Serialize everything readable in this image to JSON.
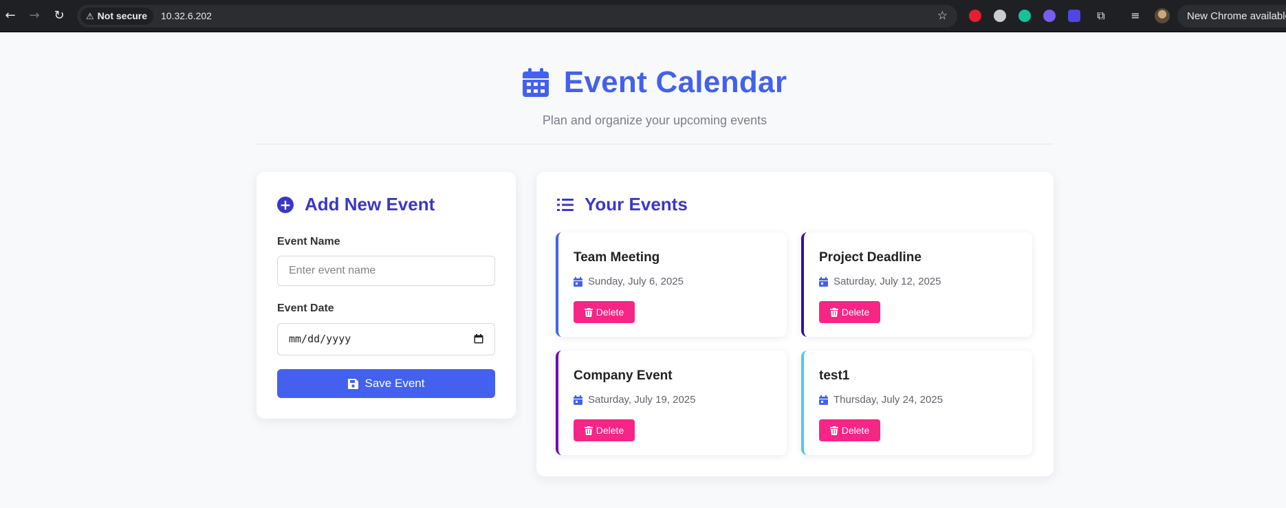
{
  "browser": {
    "security_label": "Not secure",
    "url": "10.32.6.202",
    "update_label": "New Chrome available"
  },
  "header": {
    "title": "Event Calendar",
    "subtitle": "Plan and organize your upcoming events"
  },
  "add_form": {
    "heading": "Add New Event",
    "name_label": "Event Name",
    "name_placeholder": "Enter event name",
    "name_value": "",
    "date_label": "Event Date",
    "date_value": "mm/dd/yyyy",
    "save_label": "Save Event"
  },
  "events": {
    "heading": "Your Events",
    "delete_label": "Delete",
    "items": [
      {
        "name": "Team Meeting",
        "date": "Sunday, July 6, 2025",
        "accent": "#4361ee"
      },
      {
        "name": "Project Deadline",
        "date": "Saturday, July 12, 2025",
        "accent": "#3a0ca3"
      },
      {
        "name": "Company Event",
        "date": "Saturday, July 19, 2025",
        "accent": "#7209b7"
      },
      {
        "name": "test1",
        "date": "Thursday, July 24, 2025",
        "accent": "#4cc9f0"
      }
    ]
  },
  "colors": {
    "primary": "#4361ee",
    "heading": "#3a37c7",
    "danger": "#f72585"
  },
  "icons": {
    "header": "calendar-icon",
    "add": "plus-circle-icon",
    "list": "list-icon",
    "save": "floppy-disk-icon",
    "delete": "trash-icon",
    "event_date": "calendar-day-icon"
  }
}
